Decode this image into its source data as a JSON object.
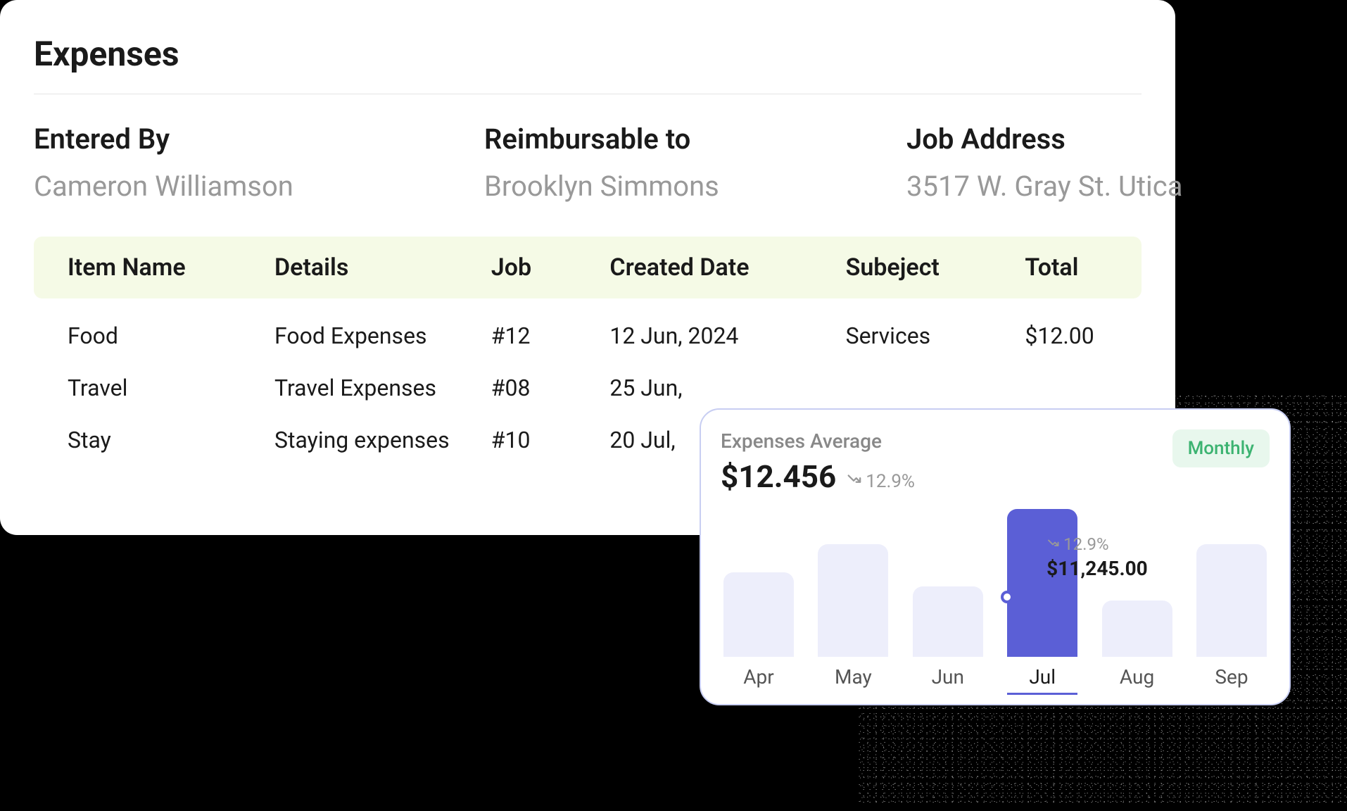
{
  "page": {
    "title": "Expenses"
  },
  "meta": {
    "entered_by": {
      "label": "Entered By",
      "value": "Cameron Williamson"
    },
    "reimbursable_to": {
      "label": "Reimbursable to",
      "value": "Brooklyn Simmons"
    },
    "job_address": {
      "label": "Job Address",
      "value": "3517 W. Gray St. Utica"
    }
  },
  "table": {
    "headers": {
      "item": "Item Name",
      "details": "Details",
      "job": "Job",
      "created": "Created Date",
      "subject": "Subeject",
      "total": "Total"
    },
    "rows": [
      {
        "item": "Food",
        "details": "Food Expenses",
        "job": "#12",
        "created": "12 Jun, 2024",
        "subject": "Services",
        "total": "$12.00"
      },
      {
        "item": "Travel",
        "details": "Travel Expenses",
        "job": "#08",
        "created": "25 Jun,",
        "subject": "",
        "total": ""
      },
      {
        "item": "Stay",
        "details": "Staying expenses",
        "job": "#10",
        "created": "20 Jul,",
        "subject": "",
        "total": ""
      }
    ]
  },
  "chart": {
    "title": "Expenses Average",
    "value": "$12.456",
    "trend_pct": "12.9%",
    "badge": "Monthly",
    "tooltip": {
      "trend_pct": "12.9%",
      "value": "$11,245.00"
    }
  },
  "chart_data": {
    "type": "bar",
    "categories": [
      "Apr",
      "May",
      "Jun",
      "Jul",
      "Aug",
      "Sep"
    ],
    "values": [
      120,
      160,
      100,
      210,
      80,
      160
    ],
    "highlight_index": 3,
    "ylim": [
      0,
      210
    ],
    "title": "Expenses Average",
    "badge": "Monthly",
    "colors": {
      "bar": "#edeefb",
      "bar_active": "#5b5fd6"
    }
  }
}
